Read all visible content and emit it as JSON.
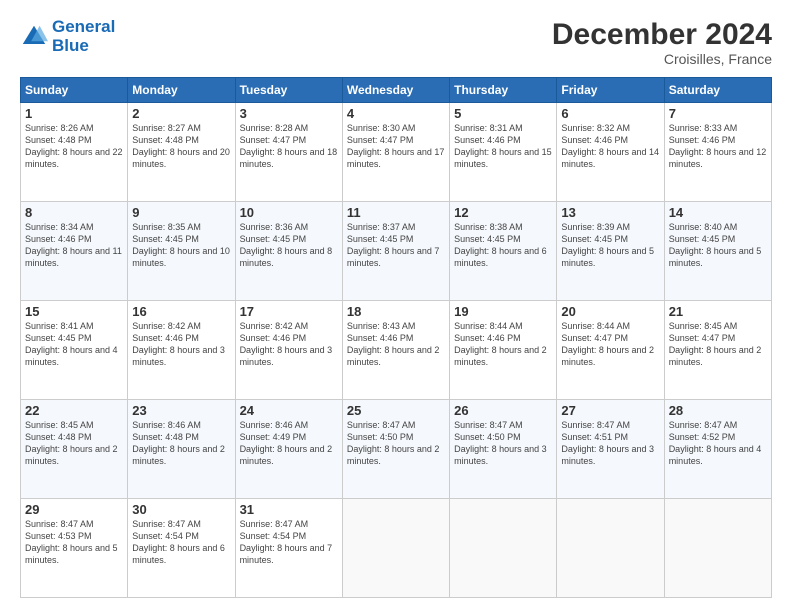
{
  "header": {
    "logo_line1": "General",
    "logo_line2": "Blue",
    "month_title": "December 2024",
    "location": "Croisilles, France"
  },
  "days_of_week": [
    "Sunday",
    "Monday",
    "Tuesday",
    "Wednesday",
    "Thursday",
    "Friday",
    "Saturday"
  ],
  "weeks": [
    [
      {
        "day": "1",
        "sunrise": "8:26 AM",
        "sunset": "4:48 PM",
        "daylight": "8 hours and 22 minutes."
      },
      {
        "day": "2",
        "sunrise": "8:27 AM",
        "sunset": "4:48 PM",
        "daylight": "8 hours and 20 minutes."
      },
      {
        "day": "3",
        "sunrise": "8:28 AM",
        "sunset": "4:47 PM",
        "daylight": "8 hours and 18 minutes."
      },
      {
        "day": "4",
        "sunrise": "8:30 AM",
        "sunset": "4:47 PM",
        "daylight": "8 hours and 17 minutes."
      },
      {
        "day": "5",
        "sunrise": "8:31 AM",
        "sunset": "4:46 PM",
        "daylight": "8 hours and 15 minutes."
      },
      {
        "day": "6",
        "sunrise": "8:32 AM",
        "sunset": "4:46 PM",
        "daylight": "8 hours and 14 minutes."
      },
      {
        "day": "7",
        "sunrise": "8:33 AM",
        "sunset": "4:46 PM",
        "daylight": "8 hours and 12 minutes."
      }
    ],
    [
      {
        "day": "8",
        "sunrise": "8:34 AM",
        "sunset": "4:46 PM",
        "daylight": "8 hours and 11 minutes."
      },
      {
        "day": "9",
        "sunrise": "8:35 AM",
        "sunset": "4:45 PM",
        "daylight": "8 hours and 10 minutes."
      },
      {
        "day": "10",
        "sunrise": "8:36 AM",
        "sunset": "4:45 PM",
        "daylight": "8 hours and 8 minutes."
      },
      {
        "day": "11",
        "sunrise": "8:37 AM",
        "sunset": "4:45 PM",
        "daylight": "8 hours and 7 minutes."
      },
      {
        "day": "12",
        "sunrise": "8:38 AM",
        "sunset": "4:45 PM",
        "daylight": "8 hours and 6 minutes."
      },
      {
        "day": "13",
        "sunrise": "8:39 AM",
        "sunset": "4:45 PM",
        "daylight": "8 hours and 5 minutes."
      },
      {
        "day": "14",
        "sunrise": "8:40 AM",
        "sunset": "4:45 PM",
        "daylight": "8 hours and 5 minutes."
      }
    ],
    [
      {
        "day": "15",
        "sunrise": "8:41 AM",
        "sunset": "4:45 PM",
        "daylight": "8 hours and 4 minutes."
      },
      {
        "day": "16",
        "sunrise": "8:42 AM",
        "sunset": "4:46 PM",
        "daylight": "8 hours and 3 minutes."
      },
      {
        "day": "17",
        "sunrise": "8:42 AM",
        "sunset": "4:46 PM",
        "daylight": "8 hours and 3 minutes."
      },
      {
        "day": "18",
        "sunrise": "8:43 AM",
        "sunset": "4:46 PM",
        "daylight": "8 hours and 2 minutes."
      },
      {
        "day": "19",
        "sunrise": "8:44 AM",
        "sunset": "4:46 PM",
        "daylight": "8 hours and 2 minutes."
      },
      {
        "day": "20",
        "sunrise": "8:44 AM",
        "sunset": "4:47 PM",
        "daylight": "8 hours and 2 minutes."
      },
      {
        "day": "21",
        "sunrise": "8:45 AM",
        "sunset": "4:47 PM",
        "daylight": "8 hours and 2 minutes."
      }
    ],
    [
      {
        "day": "22",
        "sunrise": "8:45 AM",
        "sunset": "4:48 PM",
        "daylight": "8 hours and 2 minutes."
      },
      {
        "day": "23",
        "sunrise": "8:46 AM",
        "sunset": "4:48 PM",
        "daylight": "8 hours and 2 minutes."
      },
      {
        "day": "24",
        "sunrise": "8:46 AM",
        "sunset": "4:49 PM",
        "daylight": "8 hours and 2 minutes."
      },
      {
        "day": "25",
        "sunrise": "8:47 AM",
        "sunset": "4:50 PM",
        "daylight": "8 hours and 2 minutes."
      },
      {
        "day": "26",
        "sunrise": "8:47 AM",
        "sunset": "4:50 PM",
        "daylight": "8 hours and 3 minutes."
      },
      {
        "day": "27",
        "sunrise": "8:47 AM",
        "sunset": "4:51 PM",
        "daylight": "8 hours and 3 minutes."
      },
      {
        "day": "28",
        "sunrise": "8:47 AM",
        "sunset": "4:52 PM",
        "daylight": "8 hours and 4 minutes."
      }
    ],
    [
      {
        "day": "29",
        "sunrise": "8:47 AM",
        "sunset": "4:53 PM",
        "daylight": "8 hours and 5 minutes."
      },
      {
        "day": "30",
        "sunrise": "8:47 AM",
        "sunset": "4:54 PM",
        "daylight": "8 hours and 6 minutes."
      },
      {
        "day": "31",
        "sunrise": "8:47 AM",
        "sunset": "4:54 PM",
        "daylight": "8 hours and 7 minutes."
      },
      null,
      null,
      null,
      null
    ]
  ]
}
